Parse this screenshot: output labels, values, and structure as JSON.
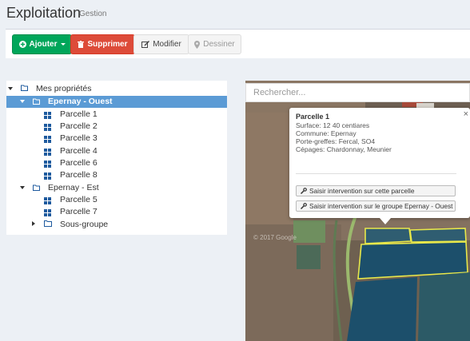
{
  "header": {
    "title": "Exploitation",
    "subtitle": "Gestion"
  },
  "toolbar": {
    "add_label": "Ajouter",
    "delete_label": "Supprimer",
    "edit_label": "Modifier",
    "draw_label": "Dessiner"
  },
  "tree": {
    "root": "Mes propriétés",
    "groups": [
      {
        "label": "Epernay - Ouest",
        "items": [
          "Parcelle 1",
          "Parcelle 2",
          "Parcelle 3",
          "Parcelle 4",
          "Parcelle 6",
          "Parcelle 8"
        ]
      },
      {
        "label": "Epernay - Est",
        "items": [
          "Parcelle 5",
          "Parcelle 7"
        ],
        "subgroup": "Sous-groupe"
      }
    ]
  },
  "map": {
    "search_placeholder": "Rechercher...",
    "watermark": "© 2017 Google",
    "popup": {
      "title": "Parcelle 1",
      "surface": "Surface: 12 40 centiares",
      "commune": "Commune: Epernay",
      "porte_greffes": "Porte-greffes: Fercal, SO4",
      "cepages": "Cépages: Chardonnay, Meunier",
      "btn_parcelle": "Saisir intervention sur cette parcelle",
      "btn_groupe": "Saisir intervention sur le groupe Epernay - Ouest"
    }
  }
}
